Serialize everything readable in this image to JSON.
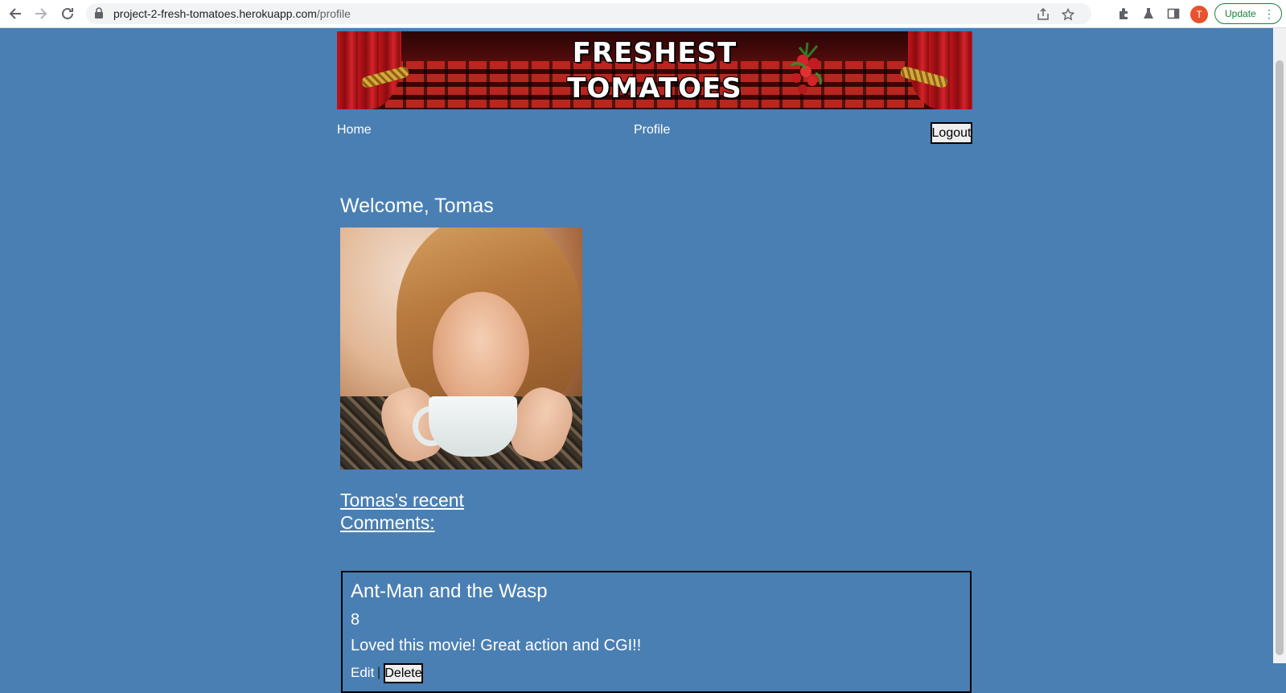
{
  "browser": {
    "url_host": "project-2-fresh-tomatoes.herokuapp.com",
    "url_path": "/profile",
    "profile_initial": "T",
    "update_label": "Update",
    "icons": [
      "back-arrow-icon",
      "forward-arrow-icon",
      "reload-icon",
      "lock-icon",
      "share-icon",
      "star-icon",
      "extensions-icon",
      "labs-icon",
      "side-panel-icon",
      "menu-dots-icon"
    ]
  },
  "banner": {
    "line1": "FRESHEST",
    "line2": "TOMATOES"
  },
  "nav": {
    "home": "Home",
    "profile": "Profile",
    "logout": "Logout"
  },
  "profile": {
    "welcome": "Welcome, Tomas",
    "comments_heading": "Tomas's recent Comments:"
  },
  "comments": [
    {
      "movie": "Ant-Man and the Wasp",
      "rating": "8",
      "text": "Loved this movie! Great action and CGI!!",
      "edit_label": "Edit",
      "separator": "|",
      "delete_label": "Delete"
    }
  ],
  "colors": {
    "page_background": "#4a7fb3",
    "text": "#ffffff",
    "update_green": "#188038",
    "avatar_orange": "#e8522f"
  }
}
